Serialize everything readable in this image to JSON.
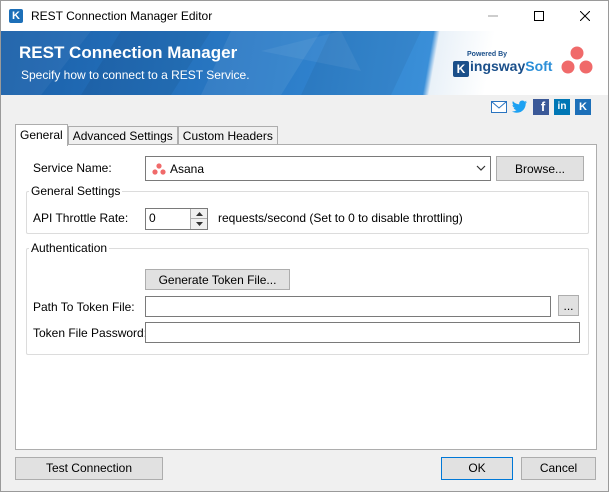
{
  "window": {
    "title": "REST Connection Manager Editor",
    "app_icon_letter": "K"
  },
  "banner": {
    "title": "REST Connection Manager",
    "subtitle": "Specify how to connect to a REST Service.",
    "vendor_powered_by": "Powered By",
    "vendor_name_k": "K",
    "vendor_name_main": "ingsway",
    "vendor_name_soft": "Soft"
  },
  "social_icons": [
    "email-icon",
    "twitter-icon",
    "facebook-icon",
    "linkedin-icon",
    "kingswaysoft-icon"
  ],
  "social_linkedin_text": "in",
  "social_facebook_text": "f",
  "social_ks_text": "K",
  "tabs": [
    {
      "label": "General",
      "active": true
    },
    {
      "label": "Advanced Settings",
      "active": false
    },
    {
      "label": "Custom Headers",
      "active": false
    }
  ],
  "general": {
    "service_name_label": "Service Name:",
    "service_name_value": "Asana",
    "browse_label": "Browse...",
    "general_settings_legend": "General Settings",
    "throttle_label": "API Throttle Rate:",
    "throttle_value": "0",
    "throttle_hint": "requests/second (Set to 0 to disable throttling)",
    "auth_legend": "Authentication",
    "generate_token_label": "Generate Token File...",
    "token_path_label": "Path To Token File:",
    "token_path_value": "",
    "token_browse_label": "...",
    "token_password_label": "Token File Password:",
    "token_password_value": ""
  },
  "footer": {
    "test_connection_label": "Test Connection",
    "ok_label": "OK",
    "cancel_label": "Cancel"
  },
  "colors": {
    "banner_dark": "#1a5fa8",
    "banner_light": "#3a8fd8",
    "asana": "#f06a6a"
  }
}
